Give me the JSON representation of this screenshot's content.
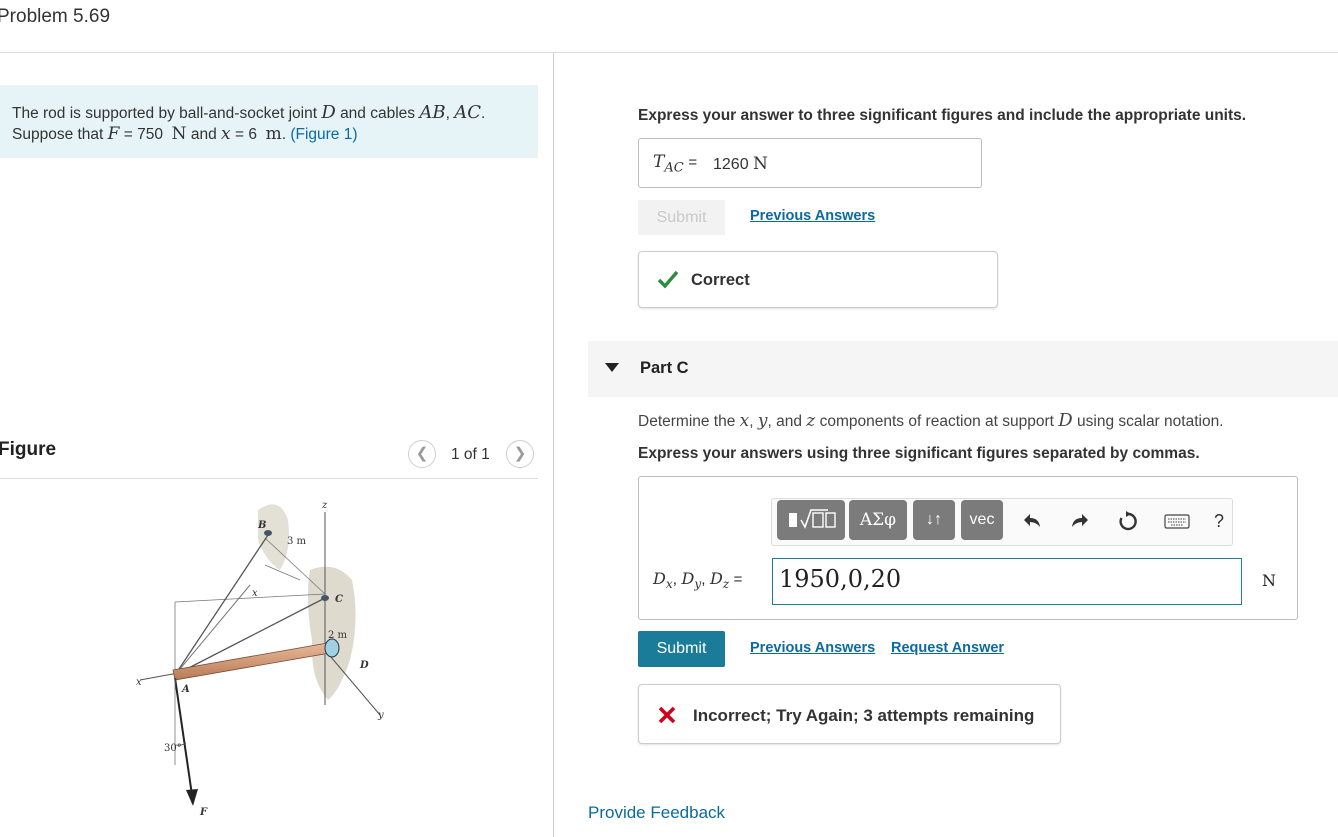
{
  "header": {
    "title": "Problem 5.69"
  },
  "intro": {
    "line1_text": "The rod is supported by ball-and-socket joint",
    "joint": "D",
    "and_cables": "and cables",
    "cable1": "AB",
    "comma": ",",
    "cable2": "AC",
    "period": ".",
    "suppose": "Suppose that",
    "F_sym": "F",
    "eq": "=",
    "F_val": "750",
    "F_unit": "N",
    "and": "and",
    "x_sym": "x",
    "x_val": "6",
    "x_unit": "m",
    "dot": ".",
    "fig_link": "(Figure 1)"
  },
  "figure": {
    "label": "Figure",
    "counter": "1 of 1",
    "prev_icon": "chevron-left-icon",
    "next_icon": "chevron-right-icon",
    "labels": {
      "B": "B",
      "z": "z",
      "three_m": "3 m",
      "x_axis": "x",
      "C": "C",
      "two_m": "2 m",
      "D": "D",
      "x_left": "x",
      "A": "A",
      "y": "y",
      "thirty": "30°",
      "F": "F"
    }
  },
  "part_b": {
    "instruction": "Express your answer to three significant figures and include the appropriate units.",
    "label_T": "T",
    "label_sub": "AC",
    "label_eq": "=",
    "value": "1260",
    "unit": "N",
    "submit_label": "Submit",
    "previous_answers": "Previous Answers",
    "result_text": "Correct",
    "result_icon": "check-icon"
  },
  "part_c": {
    "title": "Part C",
    "caret_icon": "caret-down-icon",
    "question_prefix": "Determine the",
    "qx": "x",
    "qsep1": ",",
    "qy": "y",
    "qsep2": ", and",
    "qz": "z",
    "question_mid": "components of reaction at support",
    "qD": "D",
    "question_suffix": "using scalar notation.",
    "instruction": "Express your answers using three significant figures separated by commas.",
    "toolbar": {
      "templates_icon": "templates-icon",
      "greek": "ΑΣφ",
      "arrows": "↓↑",
      "vec": "vec",
      "undo_icon": "undo-icon",
      "redo_icon": "redo-icon",
      "reset_icon": "reset-icon",
      "keyboard_icon": "keyboard-icon",
      "help": "?"
    },
    "label_D": "D",
    "sub_x": "x",
    "sub_y": "y",
    "sub_z": "z",
    "label_sep": ",",
    "label_eq": "=",
    "input_value": "1950,0,20",
    "unit": "N",
    "submit_label": "Submit",
    "previous_answers": "Previous Answers",
    "request_answer": "Request Answer",
    "result_text": "Incorrect; Try Again; 3 attempts remaining",
    "result_icon": "x-icon"
  },
  "footer": {
    "feedback": "Provide Feedback"
  },
  "colors": {
    "accent": "#1a7c98",
    "link": "#0a6aa1",
    "intro_bg": "#e6f4f7",
    "correct_green": "#2e8b3e",
    "incorrect_red": "#d0021b"
  }
}
